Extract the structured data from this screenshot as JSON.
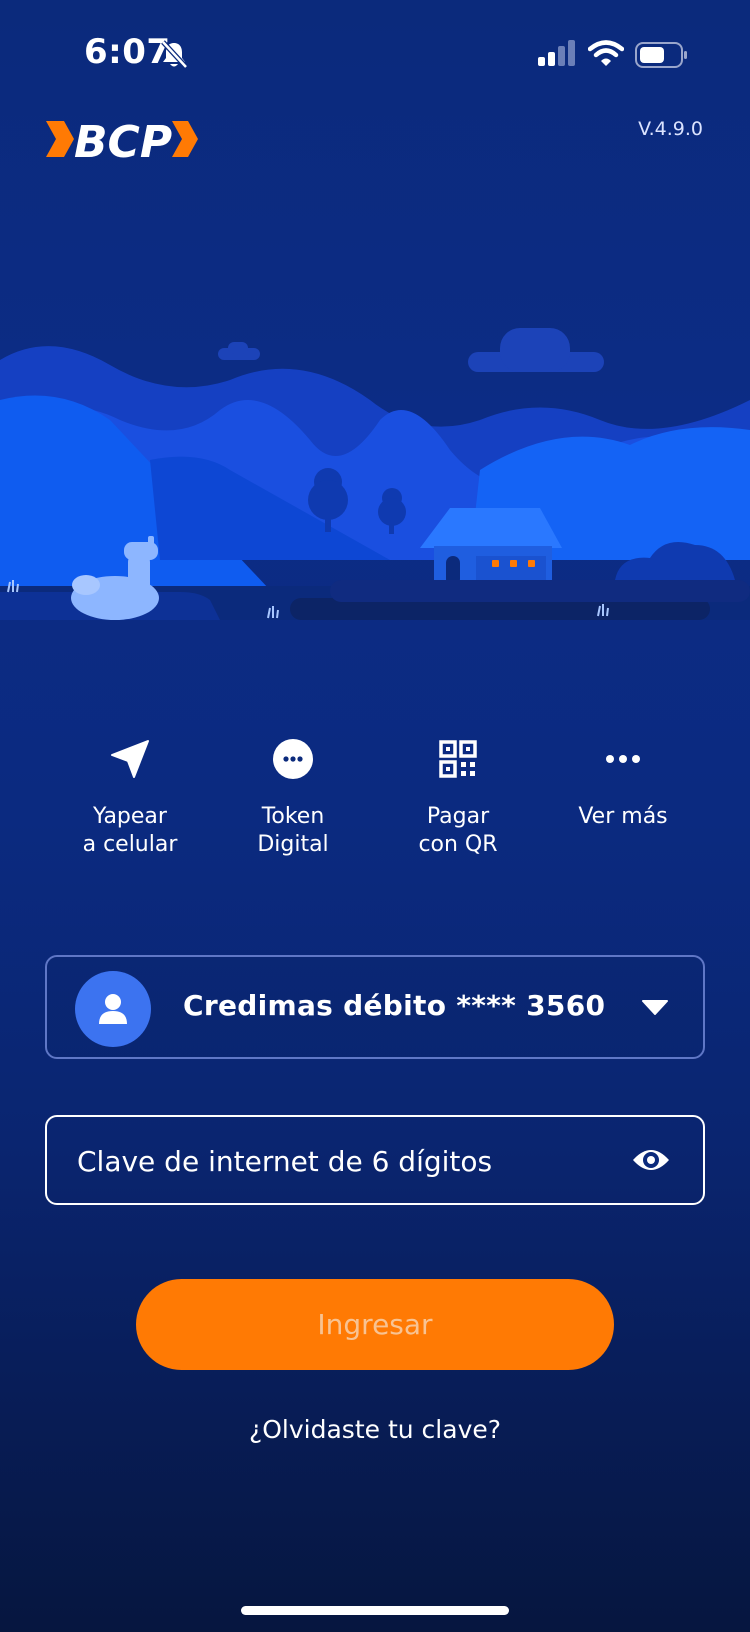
{
  "status_bar": {
    "time": "6:07",
    "icons": [
      "bell-slash-icon",
      "cellular-signal-icon",
      "wifi-icon",
      "battery-icon"
    ]
  },
  "header": {
    "logo_text": "BCP",
    "version": "V.4.9.0"
  },
  "quick_actions": [
    {
      "icon": "send-arrow-icon",
      "label": "Yapear\na celular"
    },
    {
      "icon": "token-dots-icon",
      "label": "Token\nDigital"
    },
    {
      "icon": "qr-code-icon",
      "label": "Pagar\ncon QR"
    },
    {
      "icon": "more-dots-icon",
      "label": "Ver más"
    }
  ],
  "account": {
    "label": "Credimas débito **** 3560",
    "avatar_icon": "user-icon",
    "dropdown_icon": "caret-down-icon"
  },
  "password": {
    "placeholder": "Clave de internet de 6 dígitos",
    "value": "",
    "toggle_icon": "eye-icon"
  },
  "login_button": {
    "label": "Ingresar"
  },
  "forgot_link": {
    "label": "¿Olvidaste tu clave?"
  },
  "colors": {
    "accent": "#ff7a04",
    "background": "#0b2a7c",
    "avatar": "#3c73f0"
  }
}
